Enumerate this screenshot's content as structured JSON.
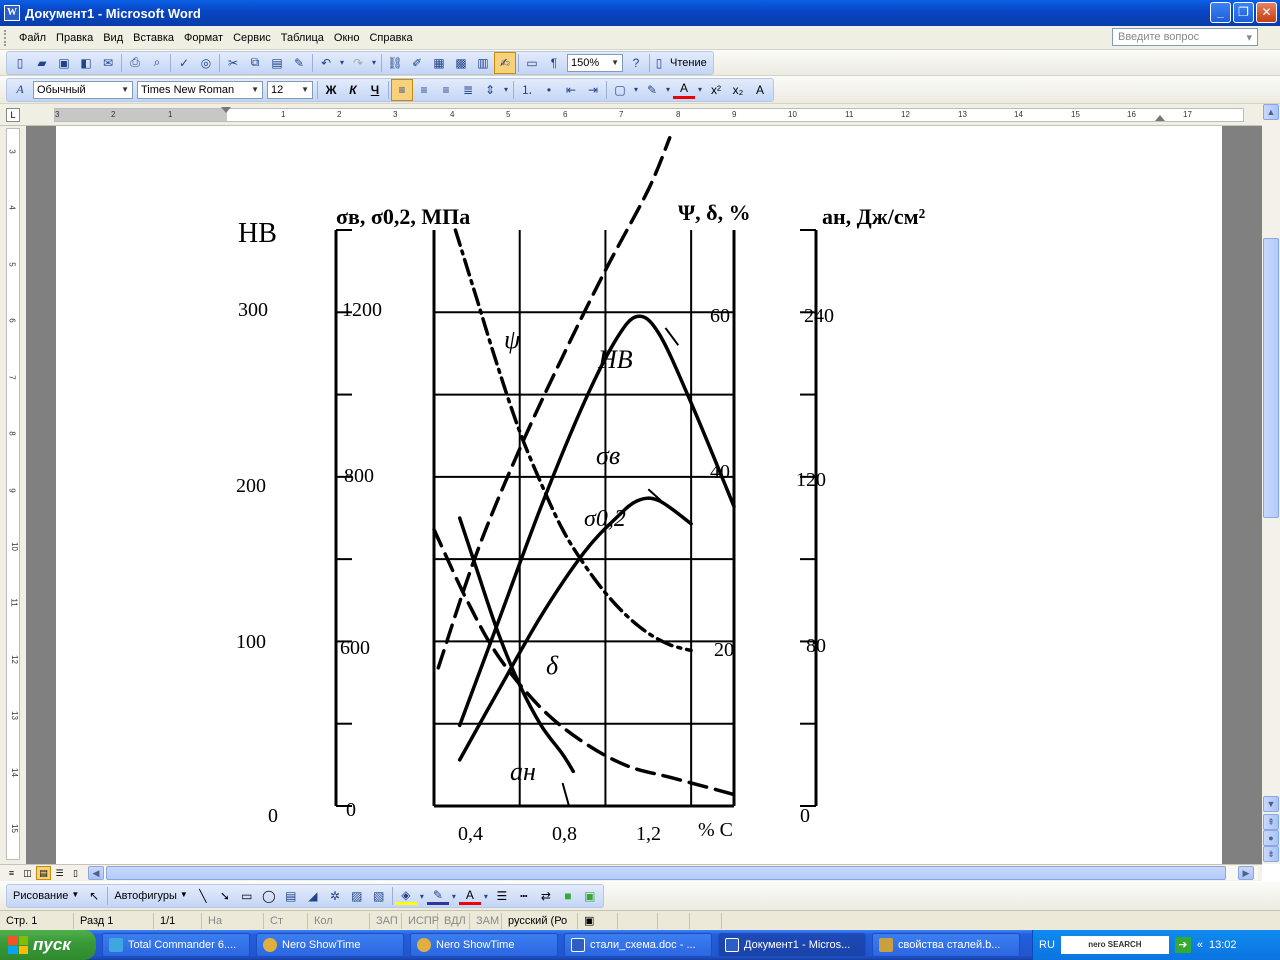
{
  "window": {
    "title": "Документ1 - Microsoft Word",
    "icon": "W"
  },
  "menu": {
    "items": [
      "Файл",
      "Правка",
      "Вид",
      "Вставка",
      "Формат",
      "Сервис",
      "Таблица",
      "Окно",
      "Справка"
    ],
    "ask_placeholder": "Введите вопрос"
  },
  "standard_toolbar": {
    "zoom": "150%",
    "reading_label": "Чтение"
  },
  "format_toolbar": {
    "style": "Обычный",
    "font": "Times New Roman",
    "size": "12"
  },
  "ruler": {
    "h_numbers": [
      "3",
      "2",
      "1",
      "1",
      "2",
      "3",
      "4",
      "5",
      "6",
      "7",
      "8",
      "9",
      "10",
      "11",
      "12",
      "13",
      "14",
      "15",
      "16",
      "17"
    ],
    "v_numbers": [
      "3",
      "4",
      "5",
      "6",
      "7",
      "8",
      "9",
      "10",
      "11",
      "12",
      "13",
      "14",
      "15"
    ]
  },
  "drawing_toolbar": {
    "draw_label": "Рисование",
    "autoshapes_label": "Автофигуры"
  },
  "status": {
    "page": "Стр. 1",
    "section": "Разд 1",
    "pages": "1/1",
    "at": "На",
    "line": "Ст",
    "col": "Кол",
    "rec": "ЗАП",
    "trk": "ИСПР",
    "ext": "ВДЛ",
    "ovr": "ЗАМ",
    "lang": "русский (Ро"
  },
  "taskbar": {
    "start": "пуск",
    "items": [
      {
        "label": "Total Commander 6....",
        "color": "#3fa7e0"
      },
      {
        "label": "Nero ShowTime",
        "color": "#e0b03f"
      },
      {
        "label": "Nero ShowTime",
        "color": "#e0b03f"
      },
      {
        "label": "стали_схема.doc - ...",
        "color": "#2c5ec6"
      },
      {
        "label": "Документ1 - Micros...",
        "color": "#2c5ec6"
      },
      {
        "label": "свойства сталей.b...",
        "color": "#c8a040"
      }
    ],
    "lang": "RU",
    "nero": "nero SEARCH",
    "clock": "13:02"
  },
  "chart_data": {
    "type": "line",
    "xlabel": "% C",
    "x_ticks": [
      "0,4",
      "0,8",
      "1,2"
    ],
    "xlim": [
      0.0,
      1.4
    ],
    "axes": [
      {
        "label": "HB",
        "ticks": [
          "300",
          "200",
          "100",
          "0"
        ]
      },
      {
        "label": "σв, σ0,2, МПа",
        "ticks": [
          "1200",
          "800",
          "600",
          "0"
        ]
      },
      {
        "label": "Ψ, δ, %",
        "ticks": [
          "60",
          "40",
          "20"
        ]
      },
      {
        "label": "aн, Дж/см²",
        "ticks": [
          "240",
          "120",
          "80",
          "0"
        ]
      }
    ],
    "series": [
      {
        "name": "HB",
        "dash": "long",
        "x": [
          0.02,
          0.2,
          0.4,
          0.6,
          0.8,
          1.0,
          1.1
        ],
        "y": [
          0.24,
          0.44,
          0.62,
          0.78,
          0.93,
          1.07,
          1.16
        ]
      },
      {
        "name": "σв",
        "dash": "solid",
        "x": [
          0.12,
          0.3,
          0.5,
          0.7,
          0.85,
          0.95,
          1.05,
          1.2,
          1.4
        ],
        "y": [
          0.14,
          0.32,
          0.52,
          0.7,
          0.81,
          0.85,
          0.82,
          0.7,
          0.52
        ]
      },
      {
        "name": "σ0,2",
        "dash": "solid",
        "x": [
          0.12,
          0.3,
          0.5,
          0.7,
          0.85,
          0.95,
          1.05,
          1.2
        ],
        "y": [
          0.08,
          0.2,
          0.33,
          0.44,
          0.5,
          0.53,
          0.53,
          0.49
        ]
      },
      {
        "name": "ψ",
        "dash": "dashdot",
        "x": [
          0.1,
          0.2,
          0.3,
          0.4,
          0.5,
          0.6,
          0.7,
          0.8,
          0.9,
          1.0,
          1.1,
          1.2
        ],
        "y": [
          1.0,
          0.88,
          0.76,
          0.65,
          0.56,
          0.48,
          0.42,
          0.37,
          0.33,
          0.3,
          0.28,
          0.27
        ]
      },
      {
        "name": "δ",
        "dash": "long",
        "x": [
          0.0,
          0.15,
          0.3,
          0.5,
          0.7,
          0.9,
          1.1,
          1.3,
          1.4
        ],
        "y": [
          0.48,
          0.36,
          0.26,
          0.17,
          0.11,
          0.07,
          0.05,
          0.03,
          0.02
        ]
      },
      {
        "name": "aн",
        "dash": "solid",
        "x": [
          0.12,
          0.2,
          0.3,
          0.4,
          0.5,
          0.6,
          0.65
        ],
        "y": [
          0.5,
          0.41,
          0.3,
          0.21,
          0.14,
          0.09,
          0.06
        ]
      }
    ]
  }
}
